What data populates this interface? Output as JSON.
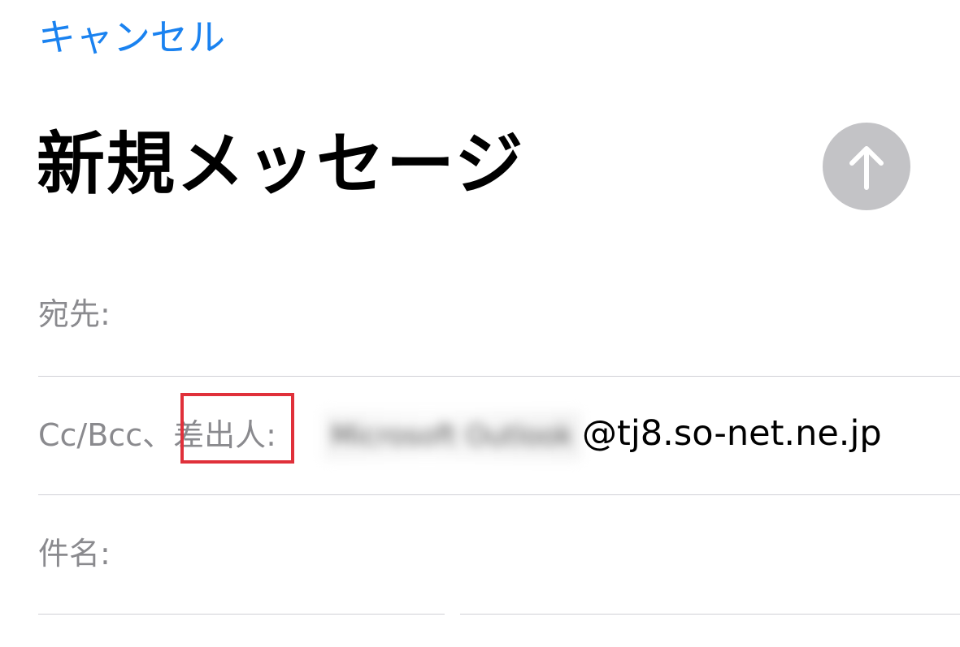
{
  "header": {
    "cancel_label": "キャンセル",
    "title": "新規メッセージ",
    "send_icon": "arrow-up-icon"
  },
  "fields": {
    "to_label": "宛先:",
    "cc_bcc_prefix": "Cc/Bcc、",
    "from_label": "差出人:",
    "from_value_blurred": "Microsoft Outlook",
    "from_value_domain": "@tj8.so-net.ne.jp",
    "subject_label": "件名:"
  },
  "colors": {
    "accent": "#1a82f0",
    "send_button_disabled": "#c3c3c6",
    "highlight": "#e0303a",
    "label_gray": "#8a8a8e"
  }
}
